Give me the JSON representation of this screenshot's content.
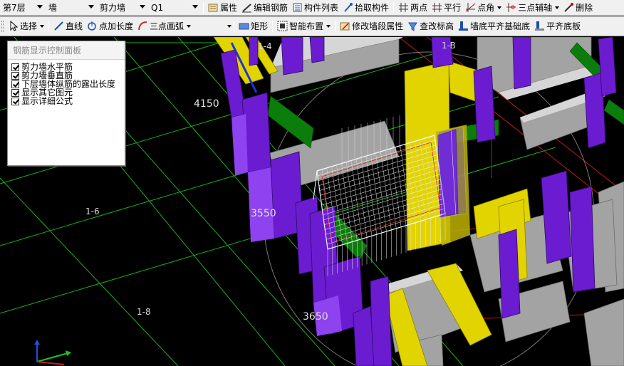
{
  "toolbar1": {
    "floor": "第7层",
    "category": "墙",
    "subtype": "剪力墙",
    "component": "Q1",
    "properties": "属性",
    "edit_rebar": "编辑钢筋",
    "component_list": "构件列表",
    "pick_component": "拾取构件",
    "two_points": "两点",
    "parallel": "平行",
    "point_angle": "点角",
    "three_point_aux": "三点辅轴",
    "delete": "删除"
  },
  "toolbar2": {
    "select": "选择",
    "line": "直线",
    "point_length": "点加长度",
    "three_point_arc": "三点画弧",
    "rectangle": "矩形",
    "smart_layout": "智能布置",
    "modify_segment": "修改墙段属性",
    "check_elevation": "查改标高",
    "align_foundation": "墙底平齐基础底",
    "align_slab": "平齐底板"
  },
  "panel": {
    "title": "钢筋显示控制面板",
    "options": [
      {
        "label": "剪力墙水平筋",
        "checked": true
      },
      {
        "label": "剪力墙垂直筋",
        "checked": true
      },
      {
        "label": "下层墙体纵筋的露出长度",
        "checked": true
      },
      {
        "label": "显示其它图元",
        "checked": true
      },
      {
        "label": "显示详细公式",
        "checked": true
      }
    ]
  },
  "viewport": {
    "dimensions": [
      "4150",
      "3550",
      "3650"
    ],
    "grid_bubbles": [
      "1-4",
      "1-6",
      "1-8",
      "1-B"
    ],
    "colors": {
      "background": "#000000",
      "grid": "#1fbf1f",
      "wall_gray": "#a3a3a3",
      "column_purple": "#7a1fd6",
      "beam_yellow": "#e6d900",
      "link_green": "#0a8a0a"
    }
  }
}
